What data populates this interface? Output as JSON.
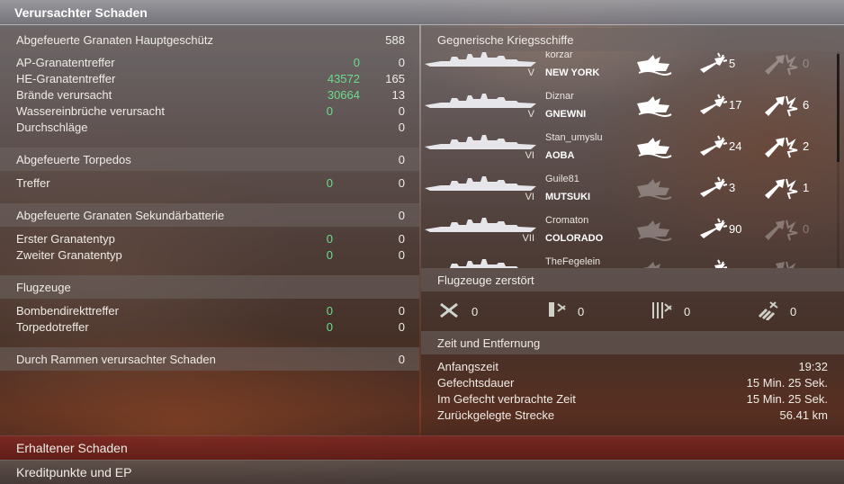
{
  "header": {
    "title": "Verursachter Schaden"
  },
  "left": {
    "main_guns": {
      "title": "Abgefeuerte Granaten Hauptgeschütz",
      "value": "588",
      "rows": [
        {
          "label": "AP-Granatentreffer",
          "green": "0",
          "value": "0"
        },
        {
          "label": "HE-Granatentreffer",
          "green": "43572",
          "value": "165"
        },
        {
          "label": "Brände verursacht",
          "green": "30664",
          "value": "13"
        },
        {
          "label": "Wassereinbrüche verursacht",
          "green": "0",
          "value": "0"
        },
        {
          "label": "Durchschläge",
          "green": "",
          "value": "0"
        }
      ]
    },
    "torpedoes": {
      "title": "Abgefeuerte Torpedos",
      "value": "0",
      "rows": [
        {
          "label": "Treffer",
          "green": "0",
          "value": "0"
        }
      ]
    },
    "secondary": {
      "title": "Abgefeuerte Granaten Sekundärbatterie",
      "value": "0",
      "rows": [
        {
          "label": "Erster Granatentyp",
          "green": "0",
          "value": "0"
        },
        {
          "label": "Zweiter Granatentyp",
          "green": "0",
          "value": "0"
        }
      ]
    },
    "aircraft": {
      "title": "Flugzeuge",
      "rows": [
        {
          "label": "Bombendirekttreffer",
          "green": "0",
          "value": "0"
        },
        {
          "label": "Torpedotreffer",
          "green": "0",
          "value": "0"
        }
      ]
    },
    "ramming": {
      "title": "Durch Rammen verursachter Schaden",
      "value": "0"
    }
  },
  "right": {
    "enemies": {
      "title": "Gegnerische Kriegsschiffe",
      "ships": [
        {
          "player": "korzar",
          "ship": "NEW YORK",
          "tier": "V",
          "damaged_dim": false,
          "hits": "5",
          "hits_dim": false,
          "kills": "0",
          "kills_dim": true
        },
        {
          "player": "Diznar",
          "ship": "GNEWNI",
          "tier": "V",
          "damaged_dim": false,
          "hits": "17",
          "hits_dim": false,
          "kills": "6",
          "kills_dim": false
        },
        {
          "player": "Stan_umyslu",
          "ship": "AOBA",
          "tier": "VI",
          "damaged_dim": false,
          "hits": "24",
          "hits_dim": false,
          "kills": "2",
          "kills_dim": false
        },
        {
          "player": "Guile81",
          "ship": "MUTSUKI",
          "tier": "VI",
          "damaged_dim": true,
          "hits": "3",
          "hits_dim": false,
          "kills": "1",
          "kills_dim": false
        },
        {
          "player": "Cromaton",
          "ship": "COLORADO",
          "tier": "VII",
          "damaged_dim": true,
          "hits": "90",
          "hits_dim": false,
          "kills": "0",
          "kills_dim": true
        },
        {
          "player": "TheFegelein",
          "ship": "",
          "tier": "",
          "damaged_dim": true,
          "hits": "",
          "hits_dim": false,
          "kills": "",
          "kills_dim": true
        }
      ]
    },
    "planes_destroyed": {
      "title": "Flugzeuge zerstört",
      "items": [
        {
          "icon": "fighter-icon",
          "value": "0"
        },
        {
          "icon": "bomber-icon",
          "value": "0"
        },
        {
          "icon": "torpedo-bomber-icon",
          "value": "0"
        },
        {
          "icon": "dive-bomber-icon",
          "value": "0"
        }
      ]
    },
    "time_distance": {
      "title": "Zeit und Entfernung",
      "rows": [
        {
          "label": "Anfangszeit",
          "value": "19:32"
        },
        {
          "label": "Gefechtsdauer",
          "value": "15 Min. 25 Sek."
        },
        {
          "label": "Im Gefecht verbrachte Zeit",
          "value": "15 Min. 25 Sek."
        },
        {
          "label": "Zurückgelegte Strecke",
          "value": "56.41 km"
        }
      ]
    }
  },
  "bottom": {
    "received": "Erhaltener Schaden",
    "credits": "Kreditpunkte und EP"
  },
  "colors": {
    "accent_green": "#6ddc8c",
    "received_bar": "#7a2a24"
  }
}
